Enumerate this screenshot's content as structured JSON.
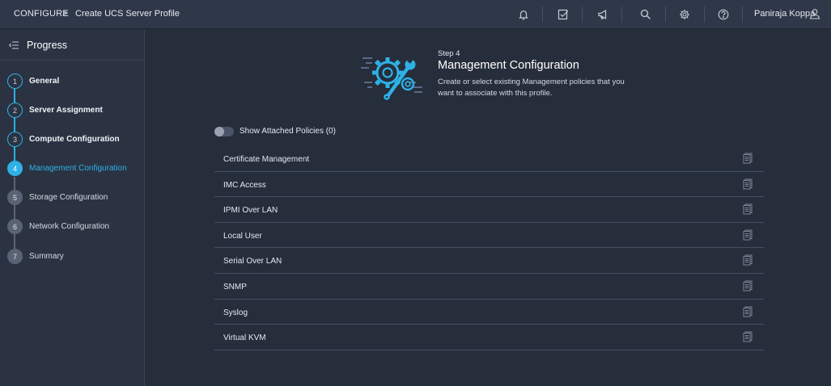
{
  "header": {
    "breadcrumb_root": "CONFIGURE",
    "breadcrumb_sep": ">",
    "breadcrumb_page": "Create UCS Server Profile",
    "user_name": "Paniraja Koppa",
    "icons": [
      "bell-icon",
      "task-check-icon",
      "megaphone-icon",
      "search-icon",
      "gear-icon",
      "help-icon",
      "user-icon"
    ]
  },
  "sidebar": {
    "title": "Progress",
    "steps": [
      {
        "number": "1",
        "label": "General",
        "state": "done"
      },
      {
        "number": "2",
        "label": "Server Assignment",
        "state": "done"
      },
      {
        "number": "3",
        "label": "Compute Configuration",
        "state": "done"
      },
      {
        "number": "4",
        "label": "Management Configuration",
        "state": "active"
      },
      {
        "number": "5",
        "label": "Storage Configuration",
        "state": "todo"
      },
      {
        "number": "6",
        "label": "Network Configuration",
        "state": "todo"
      },
      {
        "number": "7",
        "label": "Summary",
        "state": "todo"
      }
    ]
  },
  "main": {
    "step_label": "Step 4",
    "title": "Management Configuration",
    "description": "Create or select existing Management policies that you want to associate with this profile.",
    "toggle_label": "Show Attached Policies (0)",
    "toggle_on": false,
    "policies": [
      "Certificate Management",
      "IMC Access",
      "IPMI Over LAN",
      "Local User",
      "Serial Over LAN",
      "SNMP",
      "Syslog",
      "Virtual KVM"
    ]
  },
  "colors": {
    "accent": "#2eb1e6",
    "background": "#262d3b",
    "topbar": "#2f3849",
    "sidebar": "#2b3343"
  }
}
